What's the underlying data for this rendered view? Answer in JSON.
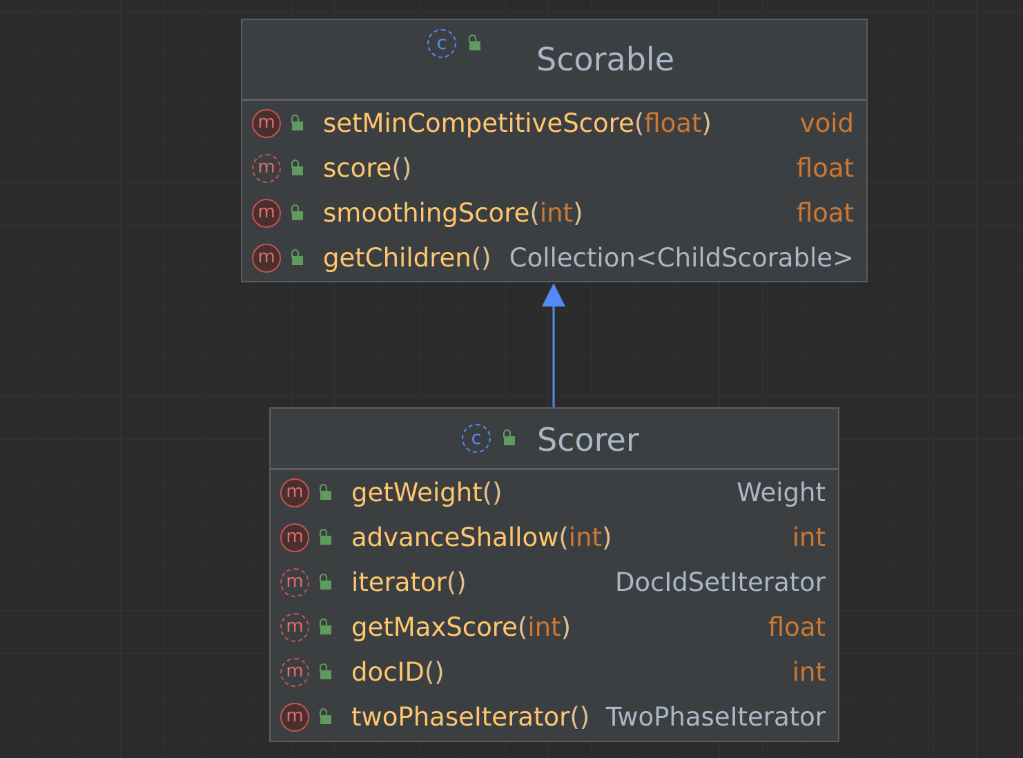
{
  "diagram": {
    "colors": {
      "background": "#2b2b2b",
      "node_fill": "#3c3f41",
      "class_icon": "#548af7",
      "method_icon": "#c75450",
      "lock_icon": "#5f9a5f",
      "method_name": "#ffc66d",
      "primitive_type": "#cc7832",
      "class_type": "#a9b7c6",
      "inheritance_arrow": "#548af7"
    },
    "scorable": {
      "title": "Scorable",
      "icons": [
        "class-icon",
        "public-lock-icon"
      ],
      "methods": [
        {
          "name": "setMinCompetitiveScore",
          "open": "(",
          "param": "float",
          "close": ")",
          "ret": "void",
          "abstract": false
        },
        {
          "name": "score",
          "open": "()",
          "param": "",
          "close": "",
          "ret": "float",
          "abstract": true
        },
        {
          "name": "smoothingScore",
          "open": "(",
          "param": "int",
          "close": ")",
          "ret": "float",
          "abstract": false
        },
        {
          "name": "getChildren",
          "open": "()",
          "param": "",
          "close": "",
          "ret": "Collection<ChildScorable>",
          "abstract": false
        }
      ]
    },
    "scorer": {
      "title": "Scorer",
      "icons": [
        "class-icon",
        "public-lock-icon"
      ],
      "methods": [
        {
          "name": "getWeight",
          "open": "()",
          "param": "",
          "close": "",
          "ret": "Weight",
          "abstract": false
        },
        {
          "name": "advanceShallow",
          "open": "(",
          "param": "int",
          "close": ")",
          "ret": "int",
          "abstract": false
        },
        {
          "name": "iterator",
          "open": "()",
          "param": "",
          "close": "",
          "ret": "DocIdSetIterator",
          "abstract": true
        },
        {
          "name": "getMaxScore",
          "open": "(",
          "param": "int",
          "close": ")",
          "ret": "float",
          "abstract": true
        },
        {
          "name": "docID",
          "open": "()",
          "param": "",
          "close": "",
          "ret": "int",
          "abstract": true
        },
        {
          "name": "twoPhaseIterator",
          "open": "()",
          "param": "",
          "close": "",
          "ret": "TwoPhaseIterator",
          "abstract": false
        }
      ]
    },
    "relation": {
      "from": "Scorer",
      "to": "Scorable",
      "kind": "inheritance"
    }
  }
}
